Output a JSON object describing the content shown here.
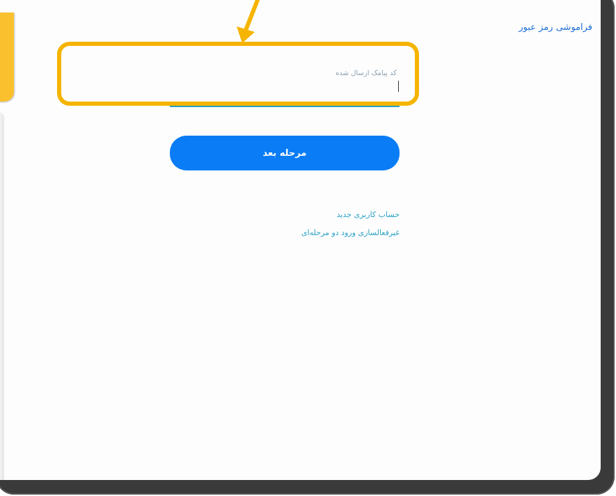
{
  "page": {
    "title": "فراموشی رمز عبور"
  },
  "form": {
    "code_input": {
      "placeholder": "کد پیامک ارسال شده",
      "value": ""
    },
    "next_button_label": "مرحله بعد"
  },
  "links": {
    "register": "حساب کاربری جدید",
    "two_step": "غیرفعالسازی ورود دو مرحله‌ای"
  },
  "annotations": {
    "highlight_color": "#f5b400",
    "arrow_color": "#f5b400"
  },
  "colors": {
    "primary_button": "#0a7cf5",
    "link": "#2aa1c4",
    "title": "#1e6fd9",
    "device_frame": "#3a3a3a"
  }
}
